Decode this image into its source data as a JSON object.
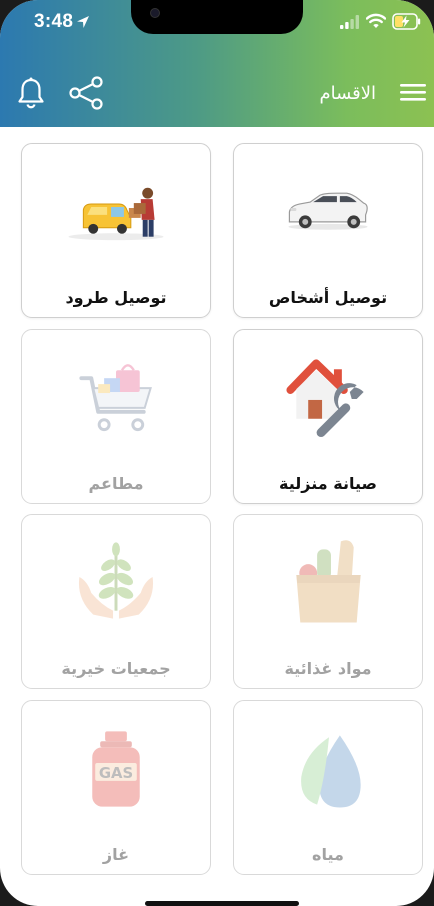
{
  "status_bar": {
    "time": "3:48",
    "icons": [
      "location-arrow-icon",
      "cellular-signal-icon",
      "wifi-icon",
      "battery-charging-icon"
    ]
  },
  "app_bar": {
    "title": "الاقسام",
    "icons": [
      "bell-icon",
      "share-icon",
      "hamburger-menu-icon"
    ],
    "gradient_colors": [
      "#2c79b0",
      "#4d9a86",
      "#8cc152"
    ]
  },
  "categories": [
    {
      "label": "توصيل أشخاص",
      "icon": "car-icon",
      "enabled": true
    },
    {
      "label": "توصيل طرود",
      "icon": "delivery-van-icon",
      "enabled": true
    },
    {
      "label": "صيانة منزلية",
      "icon": "house-wrench-icon",
      "enabled": true
    },
    {
      "label": "مطاعم",
      "icon": "shopping-cart-icon",
      "enabled": false
    },
    {
      "label": "مواد غذائية",
      "icon": "grocery-bag-icon",
      "enabled": false
    },
    {
      "label": "جمعيات خيرية",
      "icon": "hands-plant-icon",
      "enabled": false
    },
    {
      "label": "مياه",
      "icon": "water-drop-icon",
      "enabled": false
    },
    {
      "label": "غاز",
      "icon": "gas-cylinder-icon",
      "enabled": false
    }
  ],
  "gas_cylinder_text": "GAS"
}
